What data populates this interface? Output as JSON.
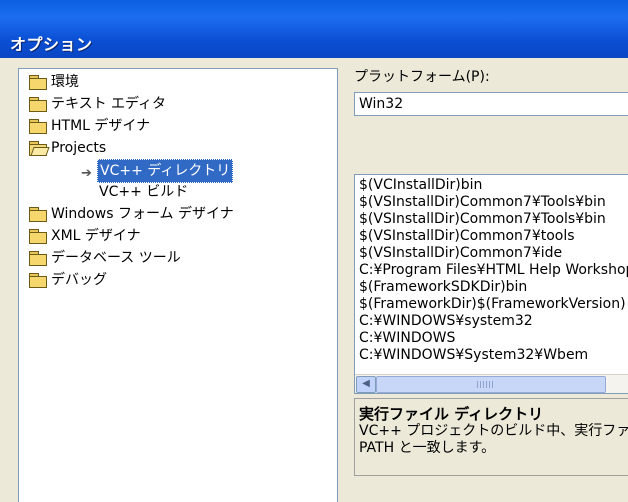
{
  "window": {
    "title": "オプション"
  },
  "tree": {
    "items": [
      {
        "label": "環境",
        "icon": "folder-icon"
      },
      {
        "label": "テキスト エディタ",
        "icon": "folder-icon"
      },
      {
        "label": "HTML デザイナ",
        "icon": "folder-icon"
      },
      {
        "label": "Projects",
        "icon": "folder-open-icon",
        "expanded": true
      },
      {
        "label": "VC++ ディレクトリ",
        "selected": true
      },
      {
        "label": "VC++ ビルド"
      },
      {
        "label": "Windows フォーム デザイナ",
        "icon": "folder-icon"
      },
      {
        "label": "XML デザイナ",
        "icon": "folder-icon"
      },
      {
        "label": "データベース ツール",
        "icon": "folder-icon"
      },
      {
        "label": "デバッグ",
        "icon": "folder-icon"
      }
    ]
  },
  "platform": {
    "label": "プラットフォーム(P):",
    "value": "Win32"
  },
  "directories": {
    "paths": [
      "$(VCInstallDir)bin",
      "$(VSInstallDir)Common7¥Tools¥bin",
      "$(VSInstallDir)Common7¥Tools¥bin",
      "$(VSInstallDir)Common7¥tools",
      "$(VSInstallDir)Common7¥ide",
      "C:¥Program Files¥HTML Help Workshop",
      "$(FrameworkSDKDir)bin",
      "$(FrameworkDir)$(FrameworkVersion)",
      "C:¥WINDOWS¥system32",
      "C:¥WINDOWS",
      "C:¥WINDOWS¥System32¥Wbem"
    ]
  },
  "description": {
    "title": "実行ファイル ディレクトリ",
    "body": "VC++ プロジェクトのビルド中、実行ファイル\nPATH と一致します。"
  }
}
